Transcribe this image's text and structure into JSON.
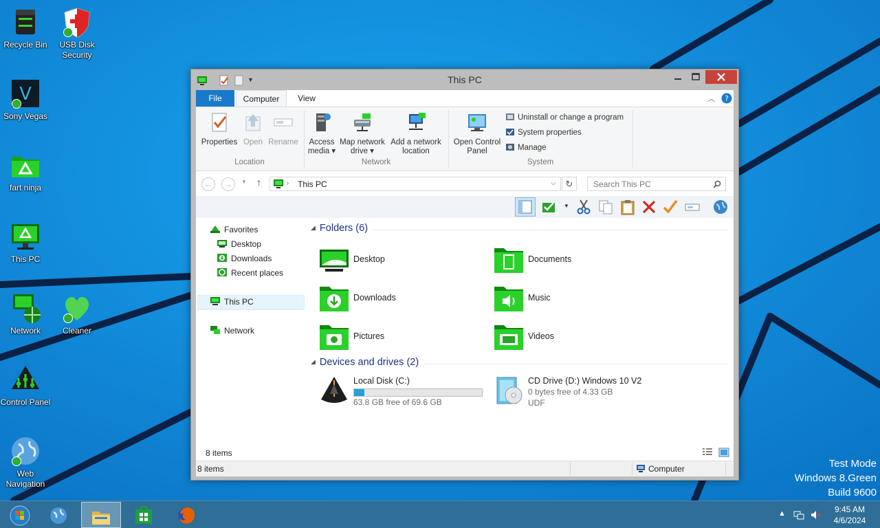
{
  "desktop": {
    "icons": [
      {
        "label": "Recycle Bin"
      },
      {
        "label": "USB Disk Security"
      },
      {
        "label": "Sony Vegas"
      },
      {
        "label": "fart ninja"
      },
      {
        "label": "This PC"
      },
      {
        "label": "Network"
      },
      {
        "label": "Cleaner"
      },
      {
        "label": "Control Panel"
      },
      {
        "label": "Web Navigation"
      }
    ],
    "watermark": {
      "line1": "Test Mode",
      "line2": "Windows 8.Green",
      "line3": "Build 9600"
    }
  },
  "window": {
    "title": "This PC",
    "tabs": {
      "file": "File",
      "computer": "Computer",
      "view": "View"
    },
    "ribbon": {
      "location": {
        "properties": "Properties",
        "open": "Open",
        "rename": "Rename",
        "group": "Location"
      },
      "network": {
        "access_media_1": "Access",
        "access_media_2": "media ▾",
        "map_drive_1": "Map network",
        "map_drive_2": "drive ▾",
        "add_location_1": "Add a network",
        "add_location_2": "location",
        "group": "Network"
      },
      "system": {
        "open_cp_1": "Open Control",
        "open_cp_2": "Panel",
        "uninstall": "Uninstall or change a program",
        "sysprops": "System properties",
        "manage": "Manage",
        "group": "System"
      }
    },
    "address": {
      "path": "This PC",
      "search_placeholder": "Search This PC"
    },
    "nav": {
      "favorites": "Favorites",
      "desktop": "Desktop",
      "downloads": "Downloads",
      "recent": "Recent places",
      "thispc": "This PC",
      "network": "Network"
    },
    "content": {
      "folders_header": "Folders (6)",
      "folders": [
        {
          "name": "Desktop"
        },
        {
          "name": "Documents"
        },
        {
          "name": "Downloads"
        },
        {
          "name": "Music"
        },
        {
          "name": "Pictures"
        },
        {
          "name": "Videos"
        }
      ],
      "drives_header": "Devices and drives (2)",
      "drives": [
        {
          "name": "Local Disk (C:)",
          "free": "63.8 GB free of 69.6 GB",
          "used_fraction": 0.083
        },
        {
          "name": "CD Drive (D:) Windows 10 V2",
          "free": "0 bytes free of 4.33 GB",
          "fs": "UDF"
        }
      ],
      "items_count": "8 items"
    },
    "status": {
      "items": "8 items",
      "location": "Computer"
    }
  },
  "taskbar": {
    "time": "9:45 AM",
    "date": "4/6/2024"
  }
}
